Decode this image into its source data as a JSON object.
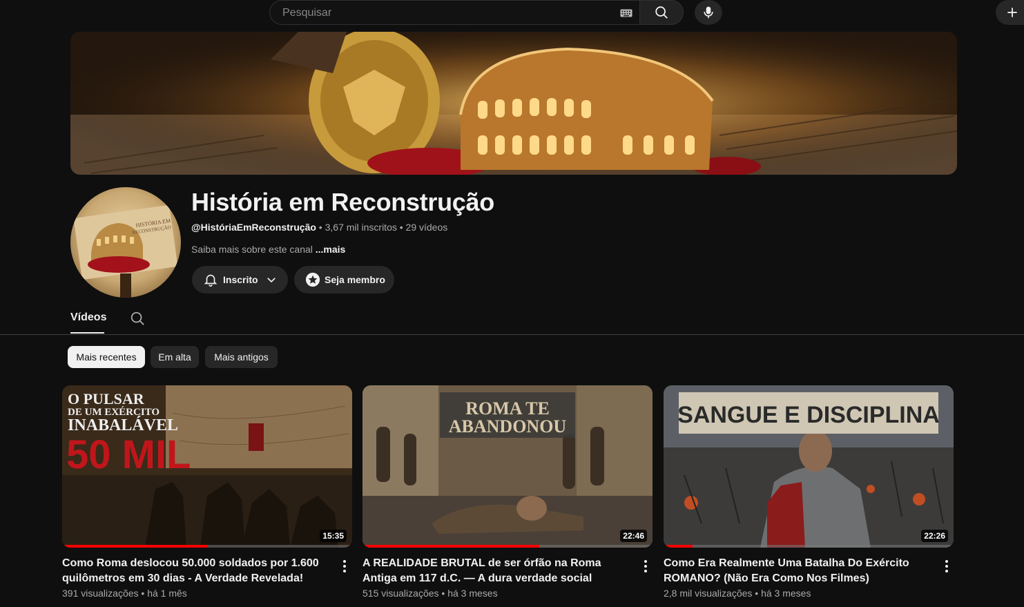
{
  "search": {
    "placeholder": "Pesquisar",
    "icon": "search-icon",
    "keyboard_icon": "keyboard-icon",
    "mic_icon": "mic-icon"
  },
  "create": {
    "icon": "plus-icon"
  },
  "channel": {
    "name": "História em Reconstrução",
    "handle": "@HistóriaEmReconstrução",
    "stats": " • 3,67 mil inscritos • 29 vídeos",
    "about_prefix": "Saiba mais sobre este canal ",
    "about_more": "...mais",
    "subscribed_label": "Inscrito",
    "member_label": "Seja membro",
    "avatar_lettering": "HISTÓRIA EM RECONSTRUÇÃO"
  },
  "tabs": [
    {
      "label": "Vídeos",
      "active": true
    }
  ],
  "chips": [
    {
      "label": "Mais recentes",
      "active": true
    },
    {
      "label": "Em alta",
      "active": false
    },
    {
      "label": "Mais antigos",
      "active": false
    }
  ],
  "videos": [
    {
      "title": "Como Roma deslocou 50.000 soldados por 1.600 quilômetros em 30 dias - A Verdade Revelada!",
      "meta": "391 visualizações • há 1 mês",
      "duration": "15:35",
      "progress": 0.5,
      "thumb_text": [
        "O PULSAR",
        "DE UM EXÉRCITO",
        "INABALÁVEL",
        "50 MIL"
      ]
    },
    {
      "title": "A REALIDADE BRUTAL de ser órfão na Roma Antiga em 117 d.C. — A dura verdade social",
      "meta": "515 visualizações • há 3 meses",
      "duration": "22:46",
      "progress": 0.61,
      "thumb_text": [
        "ROMA TE",
        "ABANDONOU"
      ]
    },
    {
      "title": "Como Era Realmente Uma Batalha Do Exército ROMANO? (Não Era Como Nos Filmes)",
      "meta": "2,8 mil visualizações • há 3 meses",
      "duration": "22:26",
      "progress": 0.1,
      "thumb_text": [
        "SANGUE E DISCIPLINA"
      ]
    }
  ],
  "colors": {
    "background": "#0f0f0f",
    "progress": "#ff0000",
    "chip_active": "#f1f1f1"
  }
}
